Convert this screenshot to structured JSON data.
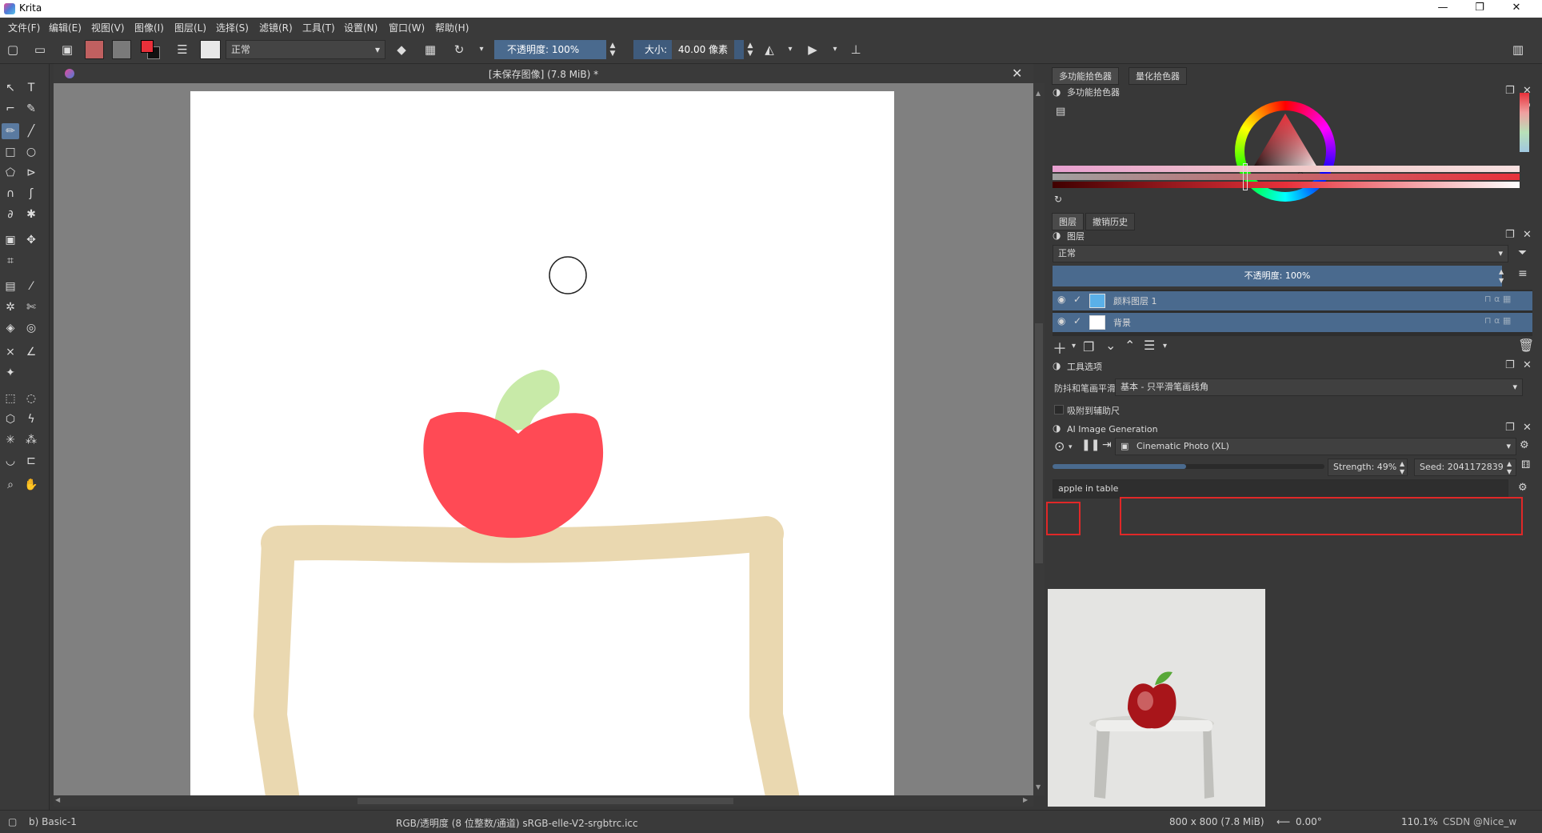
{
  "app": {
    "title": "Krita"
  },
  "window_controls": {
    "minimize": "—",
    "restore": "❐",
    "close": "✕"
  },
  "menu": [
    "文件(F)",
    "编辑(E)",
    "视图(V)",
    "图像(I)",
    "图层(L)",
    "选择(S)",
    "滤镜(R)",
    "工具(T)",
    "设置(N)",
    "窗口(W)",
    "帮助(H)"
  ],
  "toolbar": {
    "blend_mode": "正常",
    "opacity": {
      "label": "不透明度:",
      "value": "100%"
    },
    "size": {
      "label": "大小:",
      "value": "40.00 像素"
    },
    "colors": {
      "foreground": "#e8303a",
      "background": "#111111",
      "pattern": "#c06060",
      "gradient": "#7a7a7a"
    }
  },
  "document": {
    "tab_title": "[未保存图像]  (7.8 MiB) *"
  },
  "drawing": {
    "apple_color": "#ff4a55",
    "leaf_color": "#c8eaa8",
    "table_color": "#ead8b0"
  },
  "dock": {
    "top_tabs": [
      "多功能拾色器",
      "量化拾色器"
    ],
    "color_selector": {
      "title": "多功能拾色器"
    },
    "layer_tabs": [
      "图层",
      "撤销历史"
    ],
    "layers": {
      "title": "图层",
      "blend_mode": "正常",
      "opacity": {
        "label": "不透明度:",
        "value": "100%"
      },
      "items": [
        {
          "name": "颜料图层 1",
          "thumb": "#5ab0e8"
        },
        {
          "name": "背景",
          "thumb": "#ffffff"
        }
      ]
    },
    "tool_options": {
      "title": "工具选项",
      "smoothing_label": "防抖和笔画平滑",
      "smoothing_value": "基本 - 只平滑笔画线角",
      "snap_label": "吸附到辅助尺"
    },
    "ai_generation": {
      "title": "AI Image Generation",
      "style": "Cinematic Photo (XL)",
      "strength": {
        "label": "Strength:",
        "value": "49%",
        "fraction": 0.49
      },
      "seed": {
        "label": "Seed:",
        "value": "2041172839"
      },
      "prompt": "apple in table"
    }
  },
  "status": {
    "brush": "b) Basic-1",
    "color_space": "RGB/透明度 (8 位整数/通道)  sRGB-elle-V2-srgbtrc.icc",
    "dimensions": "800 x 800 (7.8 MiB)",
    "rotation": "0.00°",
    "zoom": "110.1%",
    "watermark": "CSDN @Nice_w"
  }
}
